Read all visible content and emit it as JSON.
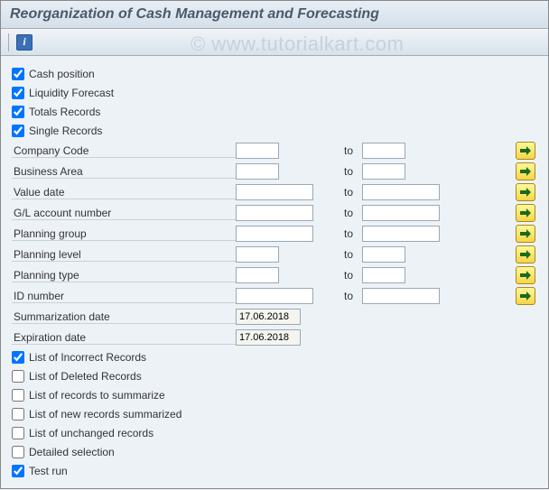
{
  "title": "Reorganization of Cash Management and Forecasting",
  "watermark": "© www.tutorialkart.com",
  "info_glyph": "i",
  "checkboxes_top": [
    {
      "label": "Cash position",
      "checked": true
    },
    {
      "label": "Liquidity Forecast",
      "checked": true
    },
    {
      "label": "Totals Records",
      "checked": true
    },
    {
      "label": "Single Records",
      "checked": true
    }
  ],
  "to_label": "to",
  "range_rows": [
    {
      "label": "Company Code",
      "from_w": "narrow",
      "to_w": "narrow",
      "multi": true
    },
    {
      "label": "Business Area",
      "from_w": "narrow",
      "to_w": "narrow",
      "multi": true
    },
    {
      "label": "Value date",
      "from_w": "wide",
      "to_w": "wide",
      "multi": true
    },
    {
      "label": "G/L account number",
      "from_w": "wide",
      "to_w": "wide",
      "multi": true
    },
    {
      "label": "Planning group",
      "from_w": "wide",
      "to_w": "wide",
      "multi": true
    },
    {
      "label": "Planning level",
      "from_w": "narrow",
      "to_w": "narrow",
      "multi": true
    },
    {
      "label": "Planning type",
      "from_w": "narrow",
      "to_w": "narrow",
      "multi": true
    },
    {
      "label": "ID number",
      "from_w": "wide",
      "to_w": "wide",
      "multi": true
    }
  ],
  "single_rows": [
    {
      "label": "Summarization date",
      "value": "17.06.2018"
    },
    {
      "label": "Expiration date",
      "value": "17.06.2018"
    }
  ],
  "checkboxes_bottom": [
    {
      "label": "List of Incorrect Records",
      "checked": true
    },
    {
      "label": "List of Deleted Records",
      "checked": false
    },
    {
      "label": "List of records to summarize",
      "checked": false
    },
    {
      "label": "List of new records summarized",
      "checked": false
    },
    {
      "label": "List of unchanged records",
      "checked": false
    },
    {
      "label": "Detailed selection",
      "checked": false
    },
    {
      "label": "Test run",
      "checked": true
    }
  ]
}
